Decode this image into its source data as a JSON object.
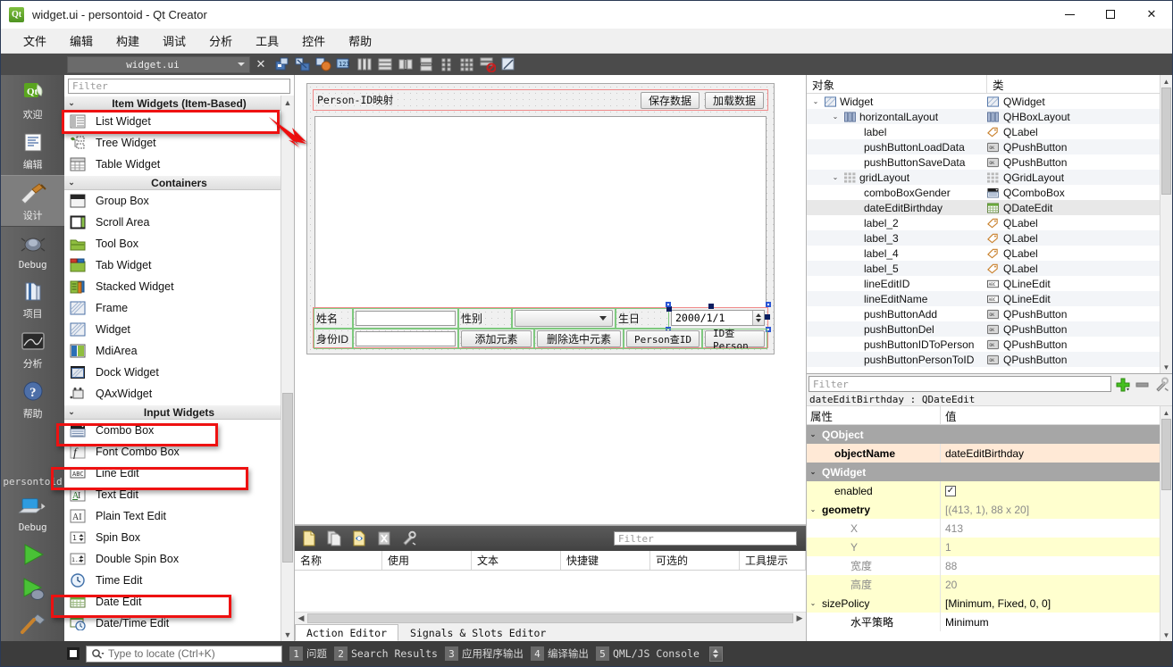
{
  "window": {
    "title": "widget.ui - persontoid - Qt Creator",
    "app_icon": "qt-logo-icon",
    "minimize": "minimize-icon",
    "maximize": "maximize-icon",
    "close": "close-icon"
  },
  "menubar": {
    "items": [
      {
        "label": "文件"
      },
      {
        "label": "编辑"
      },
      {
        "label": "构建"
      },
      {
        "label": "调试"
      },
      {
        "label": "分析"
      },
      {
        "label": "工具"
      },
      {
        "label": "控件"
      },
      {
        "label": "帮助"
      }
    ]
  },
  "designer_toolbar": {
    "file_name": "widget.ui",
    "close_label": "✕",
    "icons": [
      "edit-widgets-icon",
      "edit-signals-slots-icon",
      "edit-buddies-icon",
      "edit-tab-order-icon",
      "layout-horizontal-icon",
      "layout-vertical-icon",
      "layout-splitter-horizontal-icon",
      "layout-splitter-vertical-icon",
      "layout-form-icon",
      "layout-grid-icon",
      "break-layout-icon",
      "adjust-size-icon"
    ]
  },
  "rail": {
    "items": [
      {
        "label": "欢迎",
        "icon": "welcome-icon",
        "active": false
      },
      {
        "label": "编辑",
        "icon": "edit-icon",
        "active": false
      },
      {
        "label": "设计",
        "icon": "design-icon",
        "active": true
      },
      {
        "label": "Debug",
        "icon": "debug-bug-icon",
        "active": false
      },
      {
        "label": "项目",
        "icon": "projects-folder-icon",
        "active": false
      },
      {
        "label": "分析",
        "icon": "analyze-icon",
        "active": false
      },
      {
        "label": "帮助",
        "icon": "help-question-icon",
        "active": false
      }
    ],
    "project_name": "persontoid",
    "kit_label": "Debug",
    "kit_icon": "computer-icon",
    "run_icon": "run-play-icon",
    "debug_icon": "debug-play-icon",
    "build_icon": "build-hammer-icon"
  },
  "widget_box": {
    "filter_placeholder": "Filter",
    "groups": [
      {
        "title": "Item Widgets (Item-Based)",
        "items": [
          {
            "label": "List Widget",
            "icon": "list-widget-icon",
            "highlighted": true
          },
          {
            "label": "Tree Widget",
            "icon": "tree-widget-icon",
            "highlighted": false
          },
          {
            "label": "Table Widget",
            "icon": "table-widget-icon",
            "highlighted": false
          }
        ]
      },
      {
        "title": "Containers",
        "items": [
          {
            "label": "Group Box",
            "icon": "group-box-icon",
            "highlighted": false
          },
          {
            "label": "Scroll Area",
            "icon": "scroll-area-icon",
            "highlighted": false
          },
          {
            "label": "Tool Box",
            "icon": "tool-box-icon",
            "highlighted": false
          },
          {
            "label": "Tab Widget",
            "icon": "tab-widget-icon",
            "highlighted": false
          },
          {
            "label": "Stacked Widget",
            "icon": "stacked-widget-icon",
            "highlighted": false
          },
          {
            "label": "Frame",
            "icon": "frame-icon",
            "highlighted": false
          },
          {
            "label": "Widget",
            "icon": "widget-icon",
            "highlighted": false
          },
          {
            "label": "MdiArea",
            "icon": "mdi-area-icon",
            "highlighted": false
          },
          {
            "label": "Dock Widget",
            "icon": "dock-widget-icon",
            "highlighted": false
          },
          {
            "label": "QAxWidget",
            "icon": "qax-widget-icon",
            "highlighted": false
          }
        ]
      },
      {
        "title": "Input Widgets",
        "items": [
          {
            "label": "Combo Box",
            "icon": "combo-box-icon",
            "highlighted": true
          },
          {
            "label": "Font Combo Box",
            "icon": "font-combo-box-icon",
            "highlighted": false
          },
          {
            "label": "Line Edit",
            "icon": "line-edit-icon",
            "highlighted": true
          },
          {
            "label": "Text Edit",
            "icon": "text-edit-icon",
            "highlighted": false
          },
          {
            "label": "Plain Text Edit",
            "icon": "plain-text-edit-icon",
            "highlighted": false
          },
          {
            "label": "Spin Box",
            "icon": "spin-box-icon",
            "highlighted": false
          },
          {
            "label": "Double Spin Box",
            "icon": "double-spin-box-icon",
            "highlighted": false
          },
          {
            "label": "Time Edit",
            "icon": "time-edit-icon",
            "highlighted": false
          },
          {
            "label": "Date Edit",
            "icon": "date-edit-icon",
            "highlighted": true
          },
          {
            "label": "Date/Time Edit",
            "icon": "date-time-edit-icon",
            "highlighted": false
          }
        ]
      }
    ]
  },
  "form": {
    "title_label": "Person-ID映射",
    "buttons_top": [
      {
        "label": "保存数据",
        "name": "pushButtonSaveData"
      },
      {
        "label": "加载数据",
        "name": "pushButtonLoadData"
      }
    ],
    "row1": {
      "label_name": "姓名",
      "name_value": "",
      "label_gender": "性别",
      "gender_value": "",
      "label_birthday": "生日",
      "birthday_value": "2000/1/1"
    },
    "row2": {
      "label_id": "身份ID",
      "id_value": "",
      "btn_add": "添加元素",
      "btn_del": "删除选中元素",
      "btn_person_to_id": "Person查ID",
      "btn_id_to_person": "ID查Person"
    }
  },
  "object_tree": {
    "header": {
      "col_object": "对象",
      "col_class": "类"
    },
    "rows": [
      {
        "name": "Widget",
        "cls": "QWidget",
        "depth": 0,
        "expander": "expanded",
        "icon": "widget-icon",
        "cls_icon": "widget-icon",
        "selected": false
      },
      {
        "name": "horizontalLayout",
        "cls": "QHBoxLayout",
        "depth": 1,
        "expander": "expanded",
        "icon": "hboxlayout-icon",
        "cls_icon": "hboxlayout-icon",
        "selected": false
      },
      {
        "name": "label",
        "cls": "QLabel",
        "depth": 2,
        "expander": "none",
        "icon": "label-icon",
        "cls_icon": "label-icon",
        "selected": false
      },
      {
        "name": "pushButtonLoadData",
        "cls": "QPushButton",
        "depth": 2,
        "expander": "none",
        "icon": "pushbutton-icon",
        "cls_icon": "pushbutton-icon",
        "selected": false
      },
      {
        "name": "pushButtonSaveData",
        "cls": "QPushButton",
        "depth": 2,
        "expander": "none",
        "icon": "pushbutton-icon",
        "cls_icon": "pushbutton-icon",
        "selected": false
      },
      {
        "name": "gridLayout",
        "cls": "QGridLayout",
        "depth": 1,
        "expander": "expanded",
        "icon": "gridlayout-icon",
        "cls_icon": "gridlayout-icon",
        "selected": false
      },
      {
        "name": "comboBoxGender",
        "cls": "QComboBox",
        "depth": 2,
        "expander": "none",
        "icon": "combobox-icon",
        "cls_icon": "combobox-icon",
        "selected": false
      },
      {
        "name": "dateEditBirthday",
        "cls": "QDateEdit",
        "depth": 2,
        "expander": "none",
        "icon": "dateedit-icon",
        "cls_icon": "dateedit-icon",
        "selected": true
      },
      {
        "name": "label_2",
        "cls": "QLabel",
        "depth": 2,
        "expander": "none",
        "icon": "label-icon",
        "cls_icon": "label-icon",
        "selected": false
      },
      {
        "name": "label_3",
        "cls": "QLabel",
        "depth": 2,
        "expander": "none",
        "icon": "label-icon",
        "cls_icon": "label-icon",
        "selected": false
      },
      {
        "name": "label_4",
        "cls": "QLabel",
        "depth": 2,
        "expander": "none",
        "icon": "label-icon",
        "cls_icon": "label-icon",
        "selected": false
      },
      {
        "name": "label_5",
        "cls": "QLabel",
        "depth": 2,
        "expander": "none",
        "icon": "label-icon",
        "cls_icon": "label-icon",
        "selected": false
      },
      {
        "name": "lineEditID",
        "cls": "QLineEdit",
        "depth": 2,
        "expander": "none",
        "icon": "lineedit-icon",
        "cls_icon": "lineedit-icon",
        "selected": false
      },
      {
        "name": "lineEditName",
        "cls": "QLineEdit",
        "depth": 2,
        "expander": "none",
        "icon": "lineedit-icon",
        "cls_icon": "lineedit-icon",
        "selected": false
      },
      {
        "name": "pushButtonAdd",
        "cls": "QPushButton",
        "depth": 2,
        "expander": "none",
        "icon": "pushbutton-icon",
        "cls_icon": "pushbutton-icon",
        "selected": false
      },
      {
        "name": "pushButtonDel",
        "cls": "QPushButton",
        "depth": 2,
        "expander": "none",
        "icon": "pushbutton-icon",
        "cls_icon": "pushbutton-icon",
        "selected": false
      },
      {
        "name": "pushButtonIDToPerson",
        "cls": "QPushButton",
        "depth": 2,
        "expander": "none",
        "icon": "pushbutton-icon",
        "cls_icon": "pushbutton-icon",
        "selected": false
      },
      {
        "name": "pushButtonPersonToID",
        "cls": "QPushButton",
        "depth": 2,
        "expander": "none",
        "icon": "pushbutton-icon",
        "cls_icon": "pushbutton-icon",
        "selected": false
      }
    ]
  },
  "property_editor": {
    "filter_placeholder": "Filter",
    "add_icon": "plus-icon",
    "remove_icon": "minus-icon",
    "config_icon": "wrench-icon",
    "object_line": "dateEditBirthday : QDateEdit",
    "header": {
      "col_property": "属性",
      "col_value": "值"
    },
    "rows": [
      {
        "key": "QObject",
        "value": "",
        "type": "group",
        "depth": 0,
        "expander": "expanded"
      },
      {
        "key": "objectName",
        "value": "dateEditBirthday",
        "type": "hl",
        "depth": 1,
        "expander": "none",
        "bold": true
      },
      {
        "key": "QWidget",
        "value": "",
        "type": "group",
        "depth": 0,
        "expander": "expanded"
      },
      {
        "key": "enabled",
        "value": "",
        "type": "yel",
        "depth": 1,
        "expander": "none",
        "checkbox": true
      },
      {
        "key": "geometry",
        "value": "[(413, 1), 88 x 20]",
        "type": "yel",
        "depth": 0,
        "expander": "expanded",
        "bold": true,
        "grey_value": true
      },
      {
        "key": "X",
        "value": "413",
        "type": "wht",
        "depth": 2,
        "expander": "none",
        "grey": true,
        "grey_value": true
      },
      {
        "key": "Y",
        "value": "1",
        "type": "yel",
        "depth": 2,
        "expander": "none",
        "grey": true,
        "grey_value": true
      },
      {
        "key": "宽度",
        "value": "88",
        "type": "wht",
        "depth": 2,
        "expander": "none",
        "grey": true,
        "grey_value": true
      },
      {
        "key": "高度",
        "value": "20",
        "type": "yel",
        "depth": 2,
        "expander": "none",
        "grey": true,
        "grey_value": true
      },
      {
        "key": "sizePolicy",
        "value": "[Minimum, Fixed, 0, 0]",
        "type": "yel",
        "depth": 0,
        "expander": "expanded"
      },
      {
        "key": "水平策略",
        "value": "Minimum",
        "type": "wht",
        "depth": 2,
        "expander": "none"
      }
    ]
  },
  "action_editor": {
    "toolbar_icons": [
      "new-action-icon",
      "copy-action-icon",
      "edit-action-icon",
      "delete-action-icon",
      "configure-wrench-icon"
    ],
    "filter_placeholder": "Filter",
    "columns": [
      "名称",
      "使用",
      "文本",
      "快捷键",
      "可选的",
      "工具提示"
    ],
    "tabs": [
      {
        "label": "Action Editor",
        "active": true
      },
      {
        "label": "Signals & Slots Editor",
        "active": false
      }
    ]
  },
  "statusbar": {
    "locator_placeholder": "Type to locate (Ctrl+K)",
    "search_icon": "magnifier-icon",
    "panels": [
      {
        "num": "1",
        "label": "问题"
      },
      {
        "num": "2",
        "label": "Search Results"
      },
      {
        "num": "3",
        "label": "应用程序输出"
      },
      {
        "num": "4",
        "label": "编译输出"
      },
      {
        "num": "5",
        "label": "QML/JS Console"
      }
    ]
  },
  "colors": {
    "annotation_red": "#ee1111",
    "selection_grey": "#e8e8e8",
    "group_header": "#a6a6a6",
    "highlight_orange": "#ffe9d6",
    "highlight_yellow": "#ffffcf"
  }
}
